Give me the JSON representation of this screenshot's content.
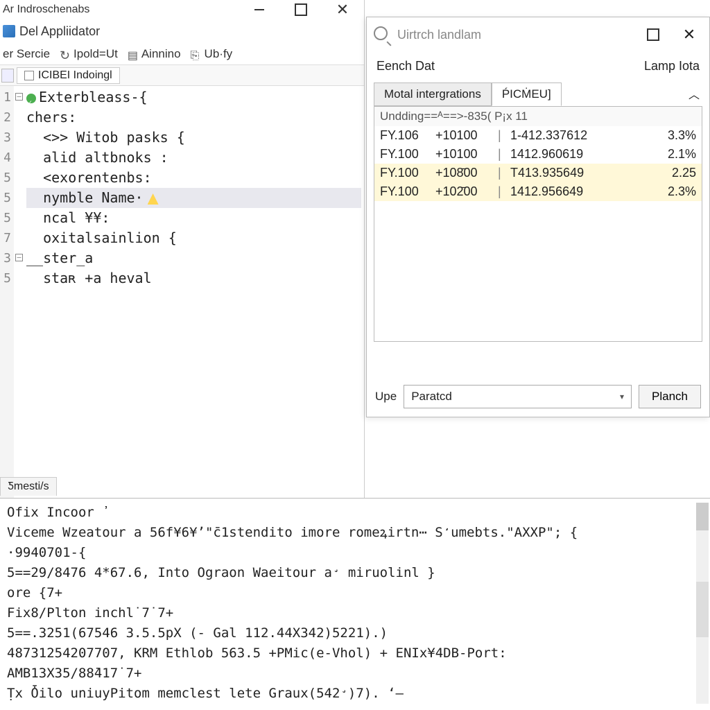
{
  "window": {
    "title": "Ar Indroschenabs",
    "subtitle": "Del Appliidator"
  },
  "toolbar": {
    "items": [
      {
        "label": "er Sercie"
      },
      {
        "label": "Ipold=Ut"
      },
      {
        "label": "Ainnino"
      },
      {
        "label": "Ub·fy"
      }
    ]
  },
  "tab": {
    "label": "ICIBEI Indoingl"
  },
  "gutter": [
    "1",
    "2",
    "3",
    "4",
    "5",
    "5",
    "5",
    "7",
    "3",
    "5"
  ],
  "code": {
    "lines": [
      "Exterbleass-{",
      "chers:",
      "  <>> Witob pasks {",
      "  alid altbnoks :",
      "  <exorentenbs:",
      "  nymble Name·",
      "  ncal ¥¥:",
      "  oxitalsainlion {",
      "__ster_a",
      "  staʀ +a heval"
    ]
  },
  "bottom_tab": "Ƽmesti/s",
  "dialog": {
    "search_placeholder": "Uirtrch landlam",
    "header_left": "Eench Dat",
    "header_right": "Lamp Iota",
    "tabs": [
      {
        "label": "Motal intergrations",
        "active": false
      },
      {
        "label": "ṔICṀEU]",
        "active": true
      }
    ],
    "panel_header": "Undding==ᴬ==>-835( P¡x 11",
    "rows": [
      {
        "c1": "FY.106",
        "c2": "+10100",
        "c4": "1-412.337612",
        "c5": "3.3%",
        "sel": false
      },
      {
        "c1": "FY.100",
        "c2": "+10100",
        "c4": "1412.960619",
        "c5": "2.1%",
        "sel": false
      },
      {
        "c1": "FY.100",
        "c2": "+108̄00",
        "c4": "T413.935649",
        "c5": "2.25",
        "sel": true
      },
      {
        "c1": "FY.100",
        "c2": "+102̄00",
        "c4": "1412.956649",
        "c5": "2.3%",
        "sel": true
      }
    ],
    "footer_label": "Upe",
    "select_value": "Paratcd",
    "button_label": "Planch"
  },
  "console": {
    "lines": [
      "Ofix Incoor ᾽",
      "Viceme Wzeatour a 56f¥6¥ʼ\"c̄1stendito imore romeꝝirtn⋯ S̒umebts.\"AXXP\"; {",
      "·9940701-{",
      "5==29/8476 4*67.6, Into Ograon Waeitour a̛ miruolinl }",
      "ore {7+",
      "Fix8/Plton inchl˙7˙7+",
      "5==.3251(67546 3.5.5pX (- Gal 112.44X342)5221).)",
      "48731254207707, KRM Ethlob 563.5 +PMic(e-Vhol) + ENIx¥4DB-Port:",
      "AMB13X35/88̄417˙7+",
      "Ṭx Ȱilo uniuyPitom memclest lete Graux(542̛)7). ʻ—"
    ]
  }
}
